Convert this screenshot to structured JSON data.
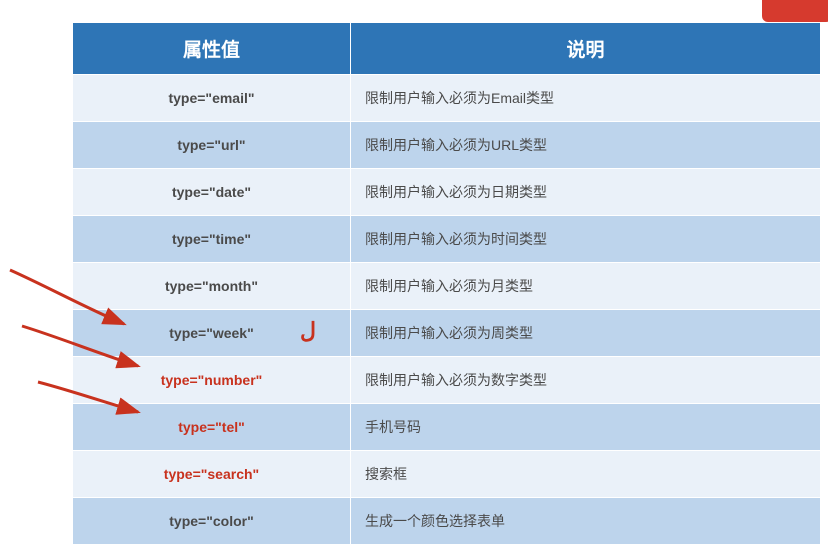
{
  "chart_data": {
    "type": "table",
    "headers": [
      "属性值",
      "说明"
    ],
    "rows": [
      {
        "attr": "type=\"email\"",
        "desc": "限制用户输入必须为Email类型",
        "highlighted": false
      },
      {
        "attr": "type=\"url\"",
        "desc": "限制用户输入必须为URL类型",
        "highlighted": false
      },
      {
        "attr": "type=\"date\"",
        "desc": "限制用户输入必须为日期类型",
        "highlighted": false
      },
      {
        "attr": "type=\"time\"",
        "desc": "限制用户输入必须为时间类型",
        "highlighted": false
      },
      {
        "attr": "type=\"month\"",
        "desc": "限制用户输入必须为月类型",
        "highlighted": false
      },
      {
        "attr": "type=\"week\"",
        "desc": "限制用户输入必须为周类型",
        "highlighted": false
      },
      {
        "attr": "type=\"number\"",
        "desc": "限制用户输入必须为数字类型",
        "highlighted": true
      },
      {
        "attr": "type=\"tel\"",
        "desc": "手机号码",
        "highlighted": true
      },
      {
        "attr": "type=\"search\"",
        "desc": "搜索框",
        "highlighted": true
      },
      {
        "attr": "type=\"color\"",
        "desc": "生成一个颜色选择表单",
        "highlighted": false
      }
    ]
  },
  "annotation_mark": "ل",
  "colors": {
    "header_bg": "#2e75b6",
    "row_light": "#eaf1f9",
    "row_dark": "#bdd4ec",
    "highlight_red": "#c8321e"
  }
}
